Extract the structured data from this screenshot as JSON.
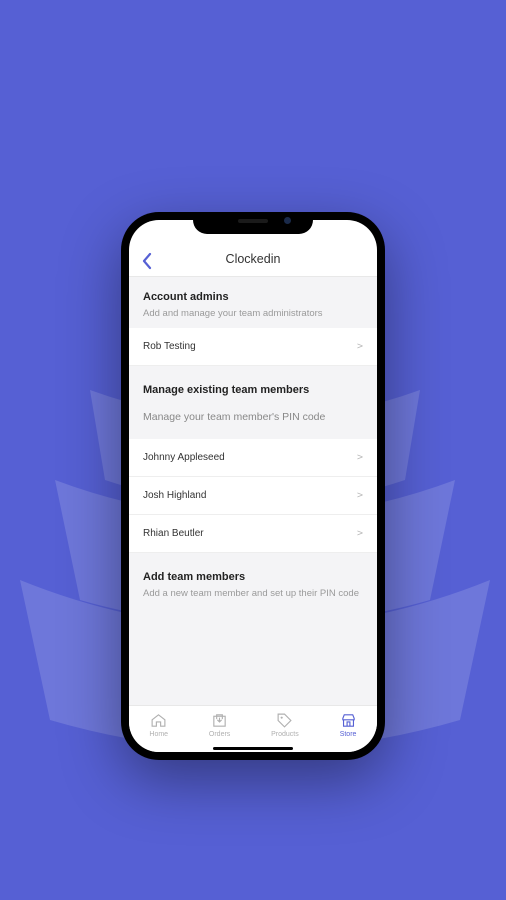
{
  "header": {
    "title": "Clockedin"
  },
  "sections": {
    "admins": {
      "title": "Account admins",
      "subtitle": "Add and manage your team administrators",
      "rows": [
        {
          "name": "Rob Testing"
        }
      ]
    },
    "manage": {
      "title": "Manage existing team members",
      "subtitle": "Manage your team member's PIN code",
      "rows": [
        {
          "name": "Johnny Appleseed"
        },
        {
          "name": "Josh Highland"
        },
        {
          "name": "Rhian Beutler"
        }
      ]
    },
    "add": {
      "title": "Add team members",
      "subtitle": "Add a new team member and set up their PIN code"
    }
  },
  "tabs": {
    "home": "Home",
    "orders": "Orders",
    "products": "Products",
    "store": "Store"
  }
}
